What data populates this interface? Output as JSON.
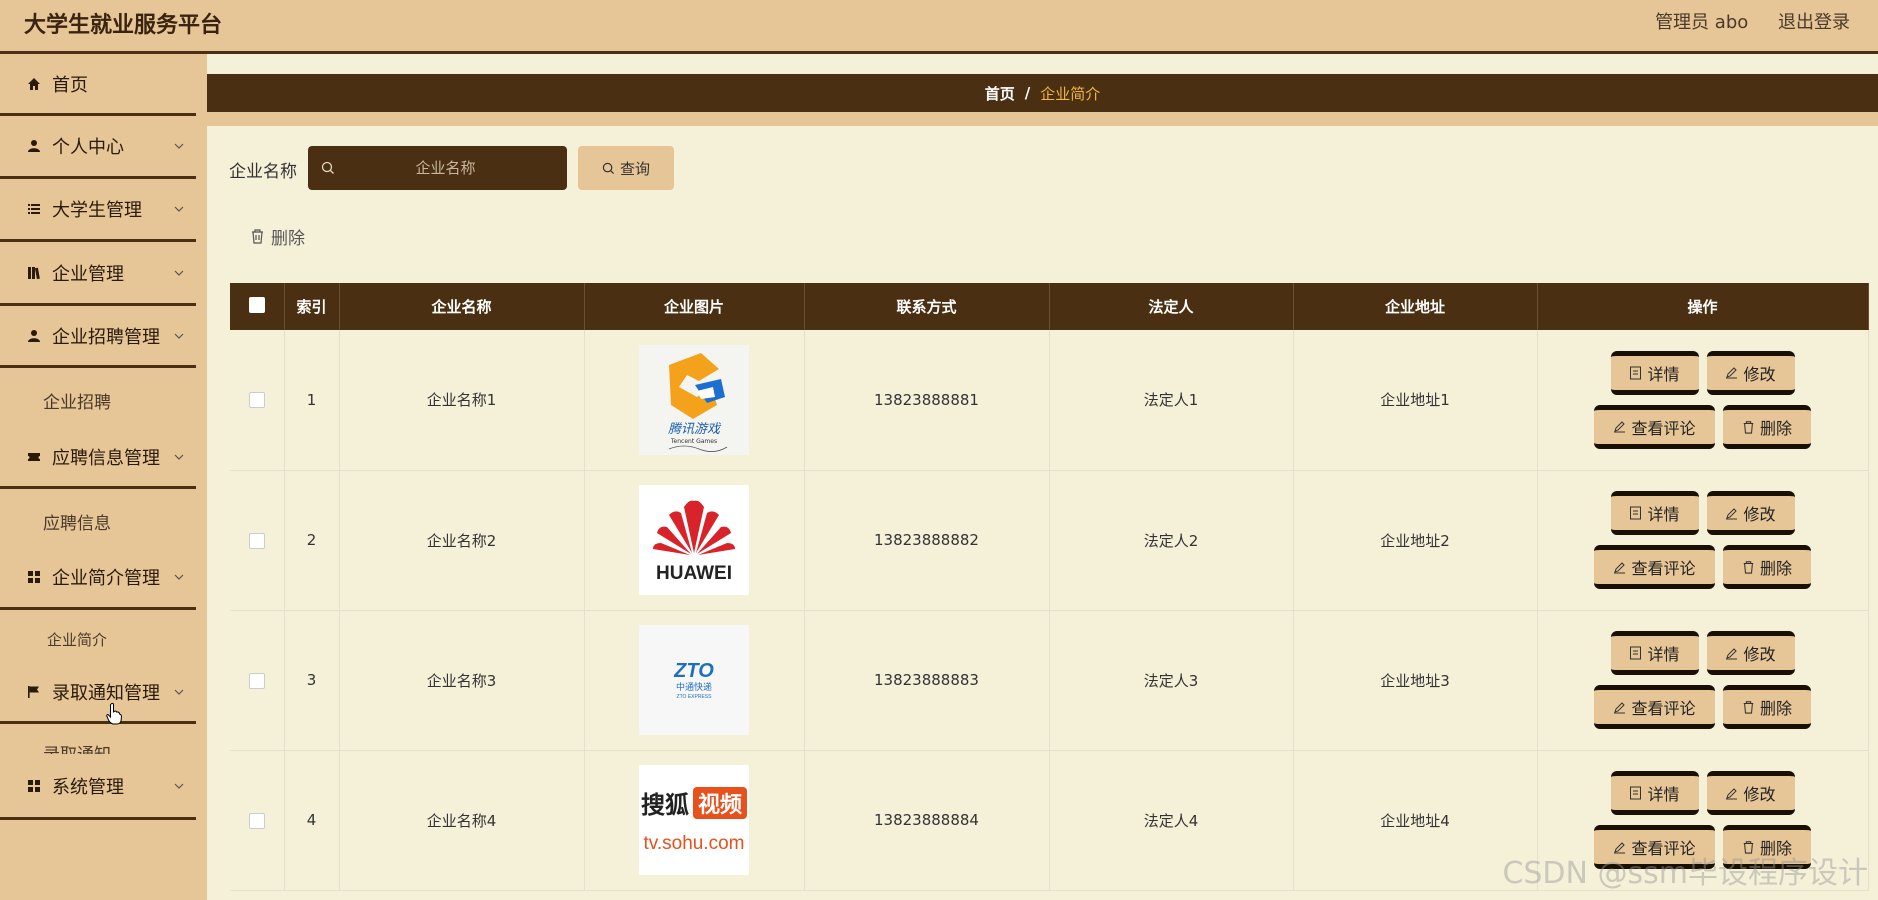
{
  "header": {
    "title": "大学生就业服务平台",
    "user": "管理员 abo",
    "logout": "退出登录"
  },
  "sidebar": {
    "items": [
      {
        "label": "首页",
        "icon": "home-icon"
      },
      {
        "label": "个人中心",
        "icon": "user-icon"
      },
      {
        "label": "大学生管理",
        "icon": "list-icon"
      },
      {
        "label": "企业管理",
        "icon": "book-icon"
      },
      {
        "label": "企业招聘管理",
        "icon": "user-icon"
      },
      {
        "label": "企业招聘",
        "sub": true
      },
      {
        "label": "应聘信息管理",
        "icon": "ticket-icon"
      },
      {
        "label": "应聘信息",
        "sub": true
      },
      {
        "label": "企业简介管理",
        "icon": "grid-icon"
      },
      {
        "label": "企业简介",
        "sub": true
      },
      {
        "label": "录取通知管理",
        "icon": "flag-icon"
      },
      {
        "label": "录取通知",
        "sub": true
      },
      {
        "label": "系统管理",
        "icon": "grid-icon"
      }
    ]
  },
  "breadcrumb": {
    "home": "首页",
    "sep": "/",
    "current": "企业简介"
  },
  "search": {
    "label": "企业名称",
    "placeholder": "企业名称",
    "button": "查询"
  },
  "bulk_delete": "删除",
  "table": {
    "headers": [
      "索引",
      "企业名称",
      "企业图片",
      "联系方式",
      "法定人",
      "企业地址",
      "操作"
    ],
    "rows": [
      {
        "index": "1",
        "name": "企业名称1",
        "logo": "Tencent Games",
        "logo_text": "腾讯游戏",
        "phone": "13823888881",
        "legal": "法定人1",
        "address": "企业地址1"
      },
      {
        "index": "2",
        "name": "企业名称2",
        "logo": "Huawei",
        "logo_text": "HUAWEI",
        "phone": "13823888882",
        "legal": "法定人2",
        "address": "企业地址2"
      },
      {
        "index": "3",
        "name": "企业名称3",
        "logo": "ZTO Express",
        "logo_text": "ZTO",
        "logo_sub": "中通快递",
        "phone": "13823888883",
        "legal": "法定人3",
        "address": "企业地址3"
      },
      {
        "index": "4",
        "name": "企业名称4",
        "logo": "Sohu Video",
        "logo_text": "搜狐视频",
        "logo_sub": "tv.sohu.com",
        "phone": "13823888884",
        "legal": "法定人4",
        "address": "企业地址4"
      }
    ],
    "ops": {
      "detail": "详情",
      "edit": "修改",
      "comments": "查看评论",
      "delete": "删除"
    }
  },
  "watermark": "CSDN @ssm毕设程序设计",
  "colors": {
    "header_bg": "#e6c596",
    "dark_brown": "#4a2f12",
    "page_bg": "#f5f0d8",
    "crumb_current": "#f0b840"
  }
}
